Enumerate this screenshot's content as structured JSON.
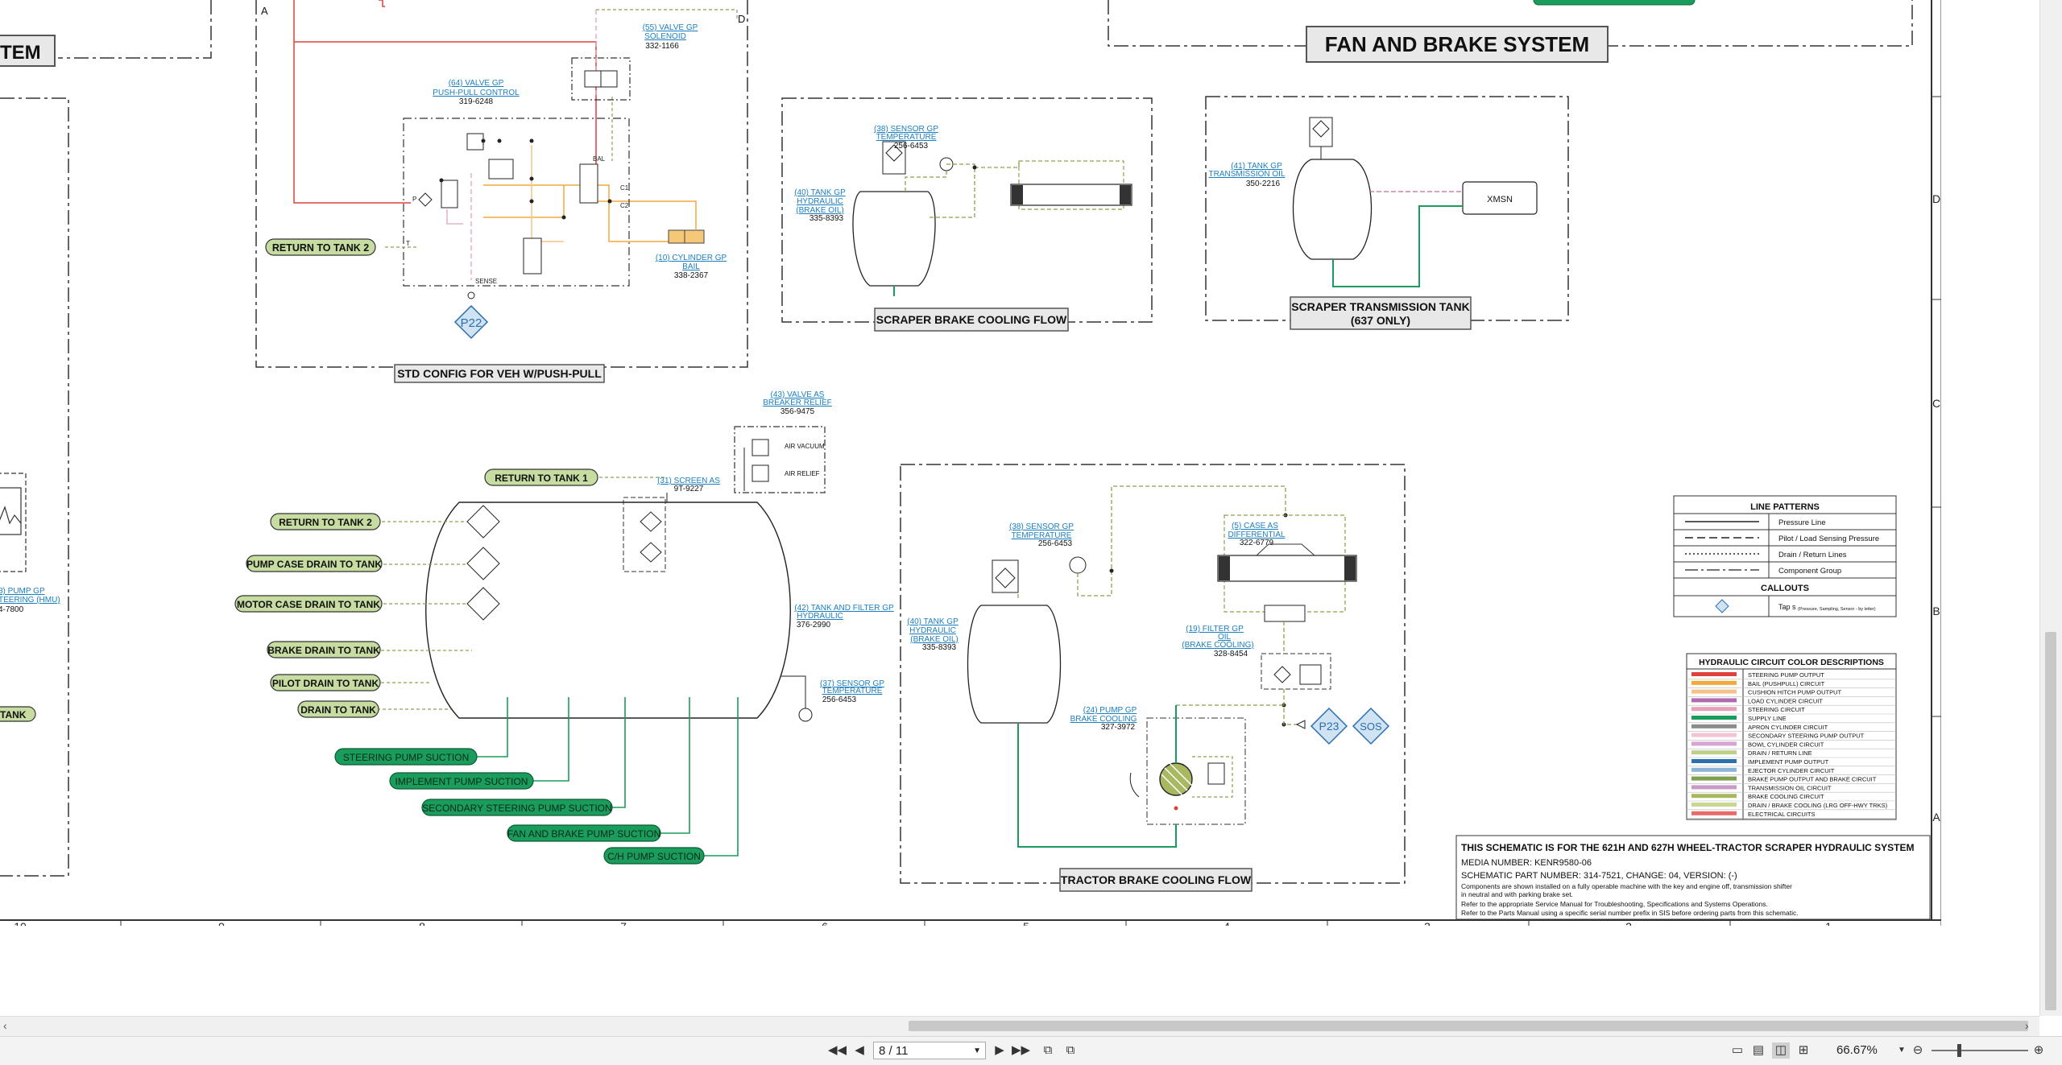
{
  "viewer": {
    "page_value": "8 / 11",
    "zoom": "66.67%",
    "icons": [
      "first-page-icon",
      "prev-page-icon",
      "next-page-icon",
      "last-page-icon",
      "fit-page-icon",
      "fit-width-icon",
      "single-page-icon",
      "continuous-icon",
      "two-page-icon",
      "rotate-icon",
      "zoom-out-icon",
      "zoom-in-icon"
    ]
  },
  "schematic": {
    "title_fan_brake": "FAN AND BRAKE SYSTEM",
    "title_left_partial": "TEM",
    "std_config_label": "STD CONFIG FOR VEH W/PUSH-PULL",
    "scraper_brake_label": "SCRAPER BRAKE COOLING FLOW",
    "scraper_trans_label_1": "SCRAPER TRANSMISSION TANK",
    "scraper_trans_label_2": "(637 ONLY)",
    "tractor_brake_label": "TRACTOR BRAKE COOLING FLOW",
    "xmsn": "XMSN",
    "return_tank_2_top": "RETURN TO TANK 2",
    "p22": "P22",
    "p23": "P23",
    "sos": "SOS",
    "tank_labels": [
      "RETURN TO TANK 1",
      "RETURN TO TANK 2",
      "PUMP CASE DRAIN TO TANK",
      "MOTOR CASE DRAIN TO TANK",
      "BRAKE DRAIN TO TANK",
      "PILOT DRAIN TO TANK",
      "DRAIN TO TANK"
    ],
    "left_tank_partial": "TANK",
    "suction_labels": [
      "STEERING PUMP SUCTION",
      "IMPLEMENT PUMP SUCTION",
      "SECONDARY STEERING PUMP SUCTION",
      "FAN AND BRAKE PUMP SUCTION",
      "C/H PUMP SUCTION"
    ],
    "callouts": {
      "c55_1": "(55) VALVE GP",
      "c55_2": "SOLENOID",
      "c55_3": "332-1166",
      "c64_1": "(64) VALVE GP",
      "c64_2": "PUSH-PULL CONTROL",
      "c64_3": "319-6248",
      "c10_1": "(10) CYLINDER GP",
      "c10_2": "BAIL",
      "c10_3": "338-2367",
      "c38a_1": "(38) SENSOR GP",
      "c38a_2": "TEMPERATURE",
      "c38a_3": "256-6453",
      "c40_1": "(40) TANK GP",
      "c40_2": "HYDRAULIC",
      "c40_3": "(BRAKE OIL)",
      "c40_4": "335-8393",
      "c41_1": "(41) TANK GP",
      "c41_2": "TRANSMISSION OIL",
      "c41_3": "350-2216",
      "c43_1": "(43) VALVE AS",
      "c43_2": "BREAKER RELIEF",
      "c43_3": "356-9475",
      "air_vacuum": "AIR VACUUM",
      "air_relief": "AIR RELIEF",
      "c31_1": "(31) SCREEN AS",
      "c31_2": "9T-9227",
      "c42_1": "(42) TANK AND FILTER GP",
      "c42_2": "HYDRAULIC",
      "c42_3": "376-2990",
      "c37_1": "(37) SENSOR GP",
      "c37_2": "TEMPERATURE",
      "c37_3": "256-6453",
      "c38b_1": "(38) SENSOR GP",
      "c38b_2": "TEMPERATURE",
      "c38b_3": "256-6453",
      "c5_1": "(5) CASE AS",
      "c5_2": "DIFFERENTIAL",
      "c5_3": "322-6779",
      "c40b_1": "(40) TANK GP",
      "c40b_2": "HYDRAULIC",
      "c40b_3": "(BRAKE OIL)",
      "c40b_4": "335-8393",
      "c19_1": "(19) FILTER GP",
      "c19_2": "OIL",
      "c19_3": "(BRAKE COOLING)",
      "c19_4": "328-8454",
      "c24_1": "(24) PUMP GP",
      "c24_2": "BRAKE COOLING",
      "c24_3": "327-3972",
      "left_pump_1": "8) PUMP GP",
      "left_pump_2": "TEERING (HMU)",
      "left_pump_3": "4-7800",
      "push_p": "P",
      "push_t": "T",
      "push_sense": "SENSE",
      "push_c1": "C1",
      "push_c2": "C2",
      "push_bal": "BAL"
    },
    "letters_top": [
      "A",
      "D"
    ],
    "grid_cols": [
      "10",
      "9",
      "8",
      "7",
      "6",
      "5",
      "4",
      "3",
      "2",
      "1"
    ],
    "grid_rows": [
      "D",
      "C",
      "B",
      "A"
    ]
  },
  "legend_lines": {
    "title": "LINE PATTERNS",
    "items": [
      "Pressure Line",
      "Pilot / Load Sensing Pressure",
      "Drain / Return Lines",
      "Component Group"
    ],
    "callouts_title": "CALLOUTS",
    "tap_label": "Tap s",
    "tap_note": "(Pressure, Sampling, Sensor - by letter)"
  },
  "legend_colors": {
    "title": "HYDRAULIC CIRCUIT COLOR DESCRIPTIONS",
    "items": [
      {
        "label": "STEERING PUMP OUTPUT",
        "color": "#e0403c"
      },
      {
        "label": "BAIL (PUSHPULL) CIRCUIT",
        "color": "#f2a93b"
      },
      {
        "label": "CUSHION HITCH PUMP OUTPUT",
        "color": "#f3c38a"
      },
      {
        "label": "LOAD CYLINDER CIRCUIT",
        "color": "#b06ab0"
      },
      {
        "label": "STEERING CIRCUIT",
        "color": "#e8a0b8"
      },
      {
        "label": "SUPPLY LINE",
        "color": "#1a9c5c"
      },
      {
        "label": "APRON CYLINDER CIRCUIT",
        "color": "#8c8c8c"
      },
      {
        "label": "SECONDARY STEERING PUMP OUTPUT",
        "color": "#f2c4d4"
      },
      {
        "label": "BOWL CYLINDER CIRCUIT",
        "color": "#d6a4d6"
      },
      {
        "label": "DRAIN / RETURN LINE",
        "color": "#bcd08a"
      },
      {
        "label": "IMPLEMENT PUMP OUTPUT",
        "color": "#2a6fb0"
      },
      {
        "label": "EJECTOR CYLINDER CIRCUIT",
        "color": "#8ab4d8"
      },
      {
        "label": "BRAKE PUMP OUTPUT AND BRAKE CIRCUIT",
        "color": "#7fa050"
      },
      {
        "label": "TRANSMISSION OIL CIRCUIT",
        "color": "#c89ac8"
      },
      {
        "label": "BRAKE COOLING CIRCUIT",
        "color": "#a8b860"
      },
      {
        "label": "DRAIN / BRAKE COOLING (LRG OFF-HWY TRKS)",
        "color": "#c8d890"
      },
      {
        "label": "ELECTRICAL CIRCUITS",
        "color": "#e86a6a"
      }
    ]
  },
  "info_block": {
    "line1": "THIS SCHEMATIC IS FOR THE 621H AND 627H WHEEL-TRACTOR SCRAPER HYDRAULIC SYSTEM",
    "line2": "MEDIA NUMBER: KENR9580-06",
    "line3": "SCHEMATIC PART NUMBER: 314-7521, CHANGE: 04, VERSION: (-)",
    "line4": "Components are shown installed on a fully operable machine with the key and engine off, transmission shifter",
    "line5": "in neutral and with parking brake set.",
    "line6": "Refer to the appropriate Service Manual for Troubleshooting, Specifications and Systems Operations.",
    "line7": "Refer to the Parts Manual using a specific serial number prefix in SIS before ordering parts from this schematic."
  }
}
